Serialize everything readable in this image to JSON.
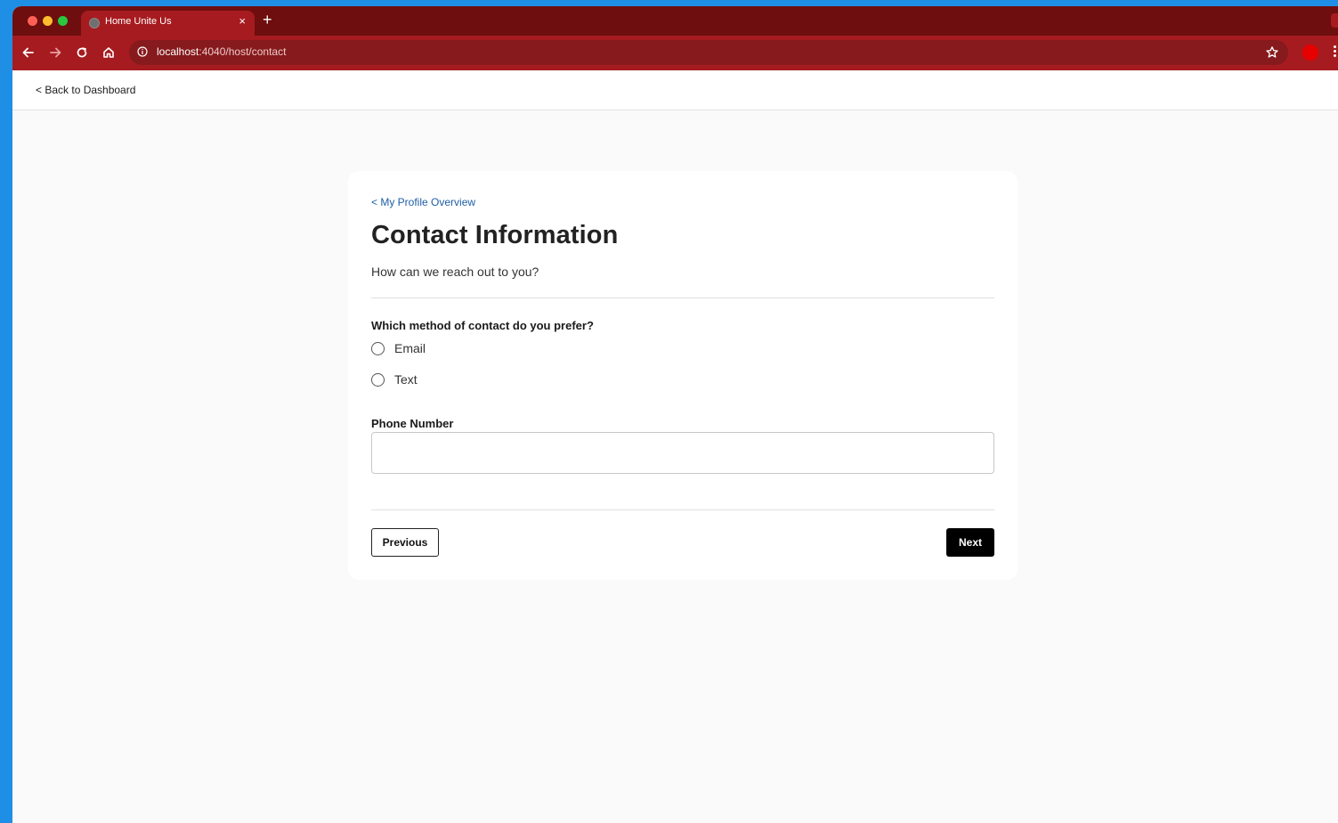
{
  "browser": {
    "tab_title": "Home Unite Us",
    "tab_close": "×",
    "new_tab": "+",
    "url_host": "localhost",
    "url_path": ":4040/host/contact"
  },
  "header": {
    "back_link": "< Back to Dashboard"
  },
  "card": {
    "breadcrumb": "< My Profile Overview",
    "title": "Contact Information",
    "subtitle": "How can we reach out to you?",
    "contact_question": "Which method of contact do you prefer?",
    "contact_options": [
      "Email",
      "Text"
    ],
    "phone_label": "Phone Number",
    "phone_value": "",
    "previous_label": "Previous",
    "next_label": "Next"
  },
  "colors": {
    "tabstrip": "#6e0e0e",
    "toolbar": "#a61b1f",
    "link": "#1d5ea6",
    "primary_button": "#000000"
  }
}
